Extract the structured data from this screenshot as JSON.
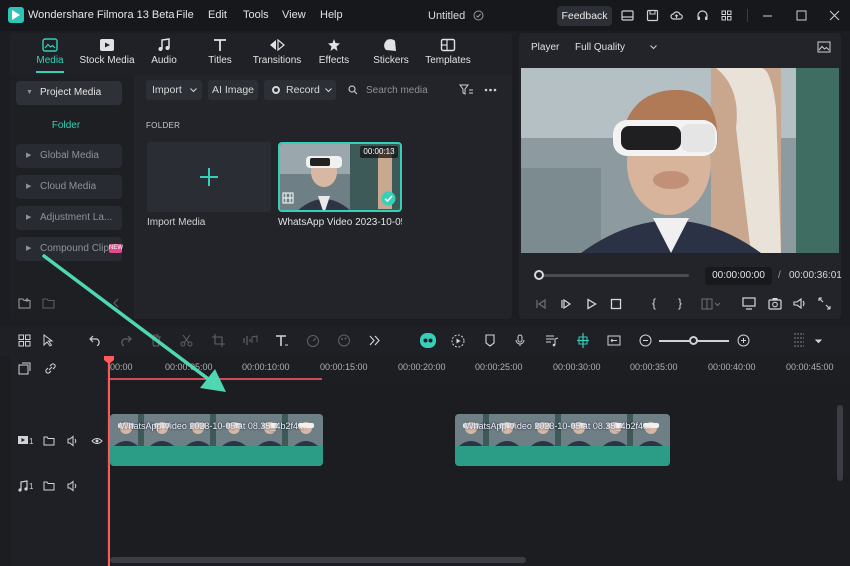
{
  "app": {
    "title": "Wondershare Filmora 13 Beta",
    "document_title": "Untitled",
    "menu": [
      "File",
      "Edit",
      "Tools",
      "View",
      "Help"
    ],
    "feedback_label": "Feedback"
  },
  "media_tabs": [
    {
      "label": "Media",
      "icon": "media-icon",
      "active": true
    },
    {
      "label": "Stock Media",
      "icon": "stock-media-icon",
      "active": false
    },
    {
      "label": "Audio",
      "icon": "music-note-icon",
      "active": false
    },
    {
      "label": "Titles",
      "icon": "text-icon",
      "active": false
    },
    {
      "label": "Transitions",
      "icon": "transitions-icon",
      "active": false
    },
    {
      "label": "Effects",
      "icon": "effects-icon",
      "active": false
    },
    {
      "label": "Stickers",
      "icon": "stickers-icon",
      "active": false
    },
    {
      "label": "Templates",
      "icon": "templates-icon",
      "active": false
    }
  ],
  "sidebar": {
    "project_media": "Project Media",
    "folder": "Folder",
    "global_media": "Global Media",
    "cloud_media": "Cloud Media",
    "adjustment_layer": "Adjustment La...",
    "compound_clip": "Compound Clip",
    "compound_badge": "NEW"
  },
  "media_toolbar": {
    "import": "Import",
    "ai_image": "AI Image",
    "record": "Record",
    "search_placeholder": "Search media"
  },
  "media_content": {
    "folder_heading": "FOLDER",
    "import_label": "Import Media",
    "video_label": "WhatsApp Video 2023-10-05...",
    "video_duration": "00:00:13"
  },
  "player": {
    "label": "Player",
    "quality": "Full Quality",
    "current_time": "00:00:00:00",
    "separator": "/",
    "total_time": "00:00:36:01",
    "progress": 0
  },
  "timeline": {
    "ruler_labels": [
      "00:00",
      "00:00:05:00",
      "00:00:10:00",
      "00:00:15:00",
      "00:00:20:00",
      "00:00:25:00",
      "00:00:30:00",
      "00:00:35:00",
      "00:00:40:00",
      "00:00:45:00"
    ],
    "clip_label": "WhatsApp Video 2023-10-05 at 08.35_4b2f4...",
    "video_track_num": "1",
    "audio_track_num": "1"
  },
  "colors": {
    "accent": "#35d0b8",
    "playhead": "#ff5a5a",
    "clip": "#2b9c86",
    "arrow": "#4fd6b2"
  }
}
